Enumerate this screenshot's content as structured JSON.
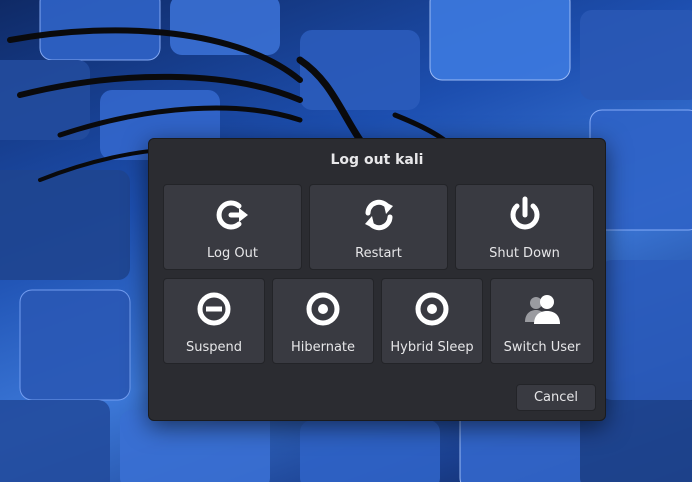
{
  "dialog": {
    "title": "Log out kali",
    "actions_row1": [
      {
        "label": "Log Out",
        "icon": "logout-icon"
      },
      {
        "label": "Restart",
        "icon": "restart-icon"
      },
      {
        "label": "Shut Down",
        "icon": "power-icon"
      }
    ],
    "actions_row2": [
      {
        "label": "Suspend",
        "icon": "suspend-icon"
      },
      {
        "label": "Hibernate",
        "icon": "hibernate-icon"
      },
      {
        "label": "Hybrid Sleep",
        "icon": "hybrid-sleep-icon"
      },
      {
        "label": "Switch User",
        "icon": "switch-user-icon"
      }
    ],
    "cancel_label": "Cancel"
  },
  "colors": {
    "dialog_bg": "#2b2c31",
    "button_bg": "#393a41",
    "text": "#e6e6e8",
    "icon": "#ffffff"
  }
}
